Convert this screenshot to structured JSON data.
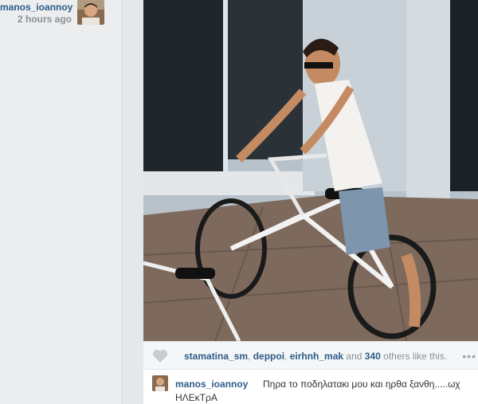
{
  "post": {
    "username": "manos_ioannoy",
    "time_ago": "2 hours ago",
    "likes": {
      "users": [
        "stamatina_sm",
        "deppoi",
        "eirhnh_mak"
      ],
      "sep1": ", ",
      "sep2": ", ",
      "and_text": " and ",
      "count": "340",
      "suffix": " others like this."
    },
    "more_label": "•••",
    "comment": {
      "username": "manos_ioannoy",
      "text_line1": "Πηρα το ποδηλατακι μου και ηρθα ξανθη.....ωχ",
      "text_line2": "ΗΛΕκΤρΑ"
    }
  },
  "colors": {
    "link": "#2d5c89",
    "muted": "#8a9096"
  }
}
